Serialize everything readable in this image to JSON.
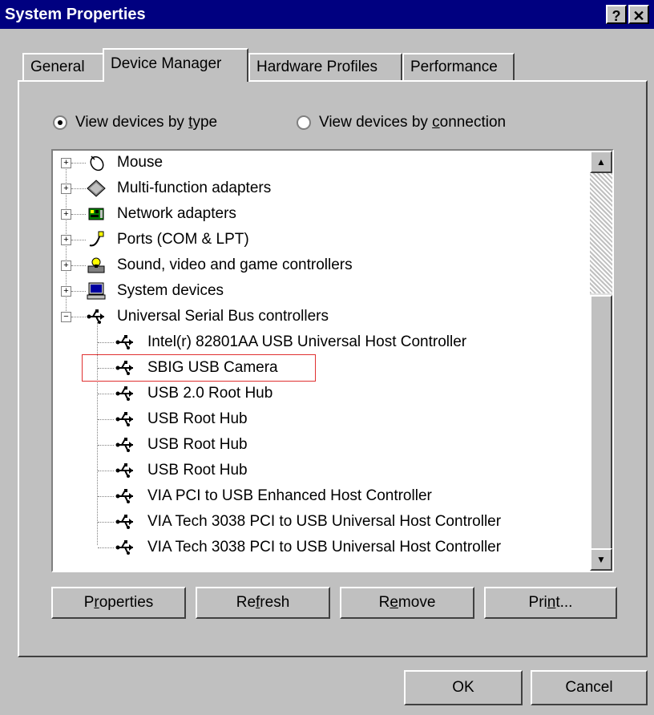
{
  "window": {
    "title": "System Properties",
    "help_label": "?",
    "close_label": "✕"
  },
  "tabs": [
    {
      "label": "General"
    },
    {
      "label": "Device Manager"
    },
    {
      "label": "Hardware Profiles"
    },
    {
      "label": "Performance"
    }
  ],
  "view": {
    "by_type_pre": "View devices by ",
    "by_type_ul": "t",
    "by_type_post": "ype",
    "by_conn_pre": "View devices by ",
    "by_conn_ul": "c",
    "by_conn_post": "onnection",
    "selected": "by_type"
  },
  "tree": {
    "categories": [
      {
        "label": "Mouse",
        "icon": "mouse-icon",
        "expander": "+"
      },
      {
        "label": "Multi-function adapters",
        "icon": "multifunction-adapter-icon",
        "expander": "+"
      },
      {
        "label": "Network adapters",
        "icon": "network-adapter-icon",
        "expander": "+"
      },
      {
        "label": "Ports (COM & LPT)",
        "icon": "port-icon",
        "expander": "+"
      },
      {
        "label": "Sound, video and game controllers",
        "icon": "sound-video-game-icon",
        "expander": "+"
      },
      {
        "label": "System devices",
        "icon": "system-devices-icon",
        "expander": "+"
      },
      {
        "label": "Universal Serial Bus controllers",
        "icon": "usb-icon",
        "expander": "−"
      }
    ],
    "usb_children": [
      {
        "label": "Intel(r) 82801AA USB Universal Host Controller"
      },
      {
        "label": "SBIG USB Camera"
      },
      {
        "label": "USB 2.0 Root Hub"
      },
      {
        "label": "USB Root Hub"
      },
      {
        "label": "USB Root Hub"
      },
      {
        "label": "USB Root Hub"
      },
      {
        "label": "VIA PCI to USB Enhanced Host Controller"
      },
      {
        "label": "VIA Tech 3038 PCI to USB Universal Host Controller"
      },
      {
        "label": "VIA Tech 3038 PCI to USB Universal Host Controller"
      }
    ],
    "highlighted_index": 1
  },
  "scrollbar": {
    "up_arrow": "▲",
    "down_arrow": "▼"
  },
  "buttons": {
    "properties_pre": "P",
    "properties_ul": "r",
    "properties_post": "operties",
    "refresh_pre": "Re",
    "refresh_ul": "f",
    "refresh_post": "resh",
    "remove_pre": "R",
    "remove_ul": "e",
    "remove_post": "move",
    "print_pre": "Pri",
    "print_ul": "n",
    "print_post": "t...",
    "ok": "OK",
    "cancel": "Cancel"
  },
  "colors": {
    "titlebar": "#000080",
    "face": "#c0c0c0",
    "highlight_box": "#e03030"
  }
}
